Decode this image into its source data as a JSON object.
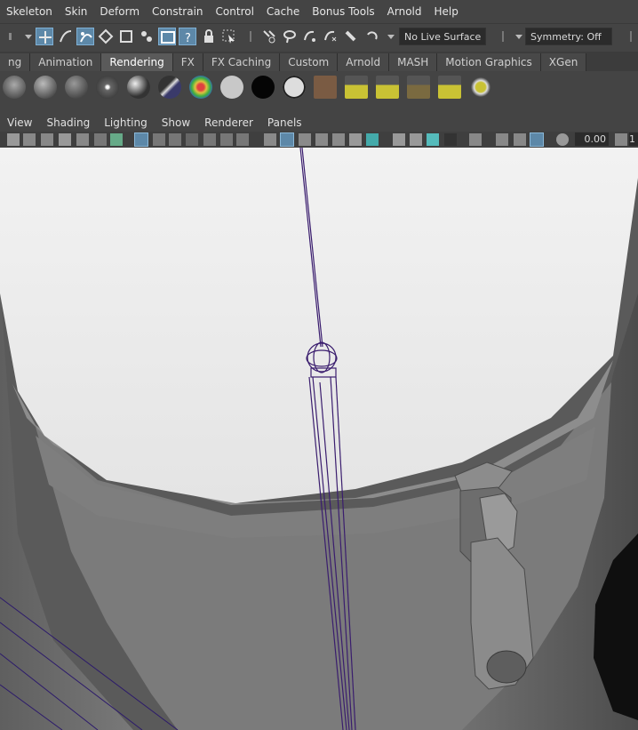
{
  "main_menu": [
    "Skeleton",
    "Skin",
    "Deform",
    "Constrain",
    "Control",
    "Cache",
    "Bonus Tools",
    "Arnold",
    "Help"
  ],
  "status_line": {
    "live_surface": "No Live Surface",
    "symmetry": "Symmetry: Off"
  },
  "shelf_tabs": [
    {
      "label": "ng",
      "active": false
    },
    {
      "label": "Animation",
      "active": false
    },
    {
      "label": "Rendering",
      "active": true
    },
    {
      "label": "FX",
      "active": false
    },
    {
      "label": "FX Caching",
      "active": false
    },
    {
      "label": "Custom",
      "active": false
    },
    {
      "label": "Arnold",
      "active": false
    },
    {
      "label": "MASH",
      "active": false
    },
    {
      "label": "Motion Graphics",
      "active": false
    },
    {
      "label": "XGen",
      "active": false
    }
  ],
  "panel_menu": [
    "View",
    "Shading",
    "Lighting",
    "Show",
    "Renderer",
    "Panels"
  ],
  "panel_toolbar": {
    "exposure_value": "0.00",
    "gamma_value_partial": "1"
  },
  "colors": {
    "ui_bg": "#444444",
    "selected": "#5d88a8",
    "wire": "#3a1d6e"
  }
}
